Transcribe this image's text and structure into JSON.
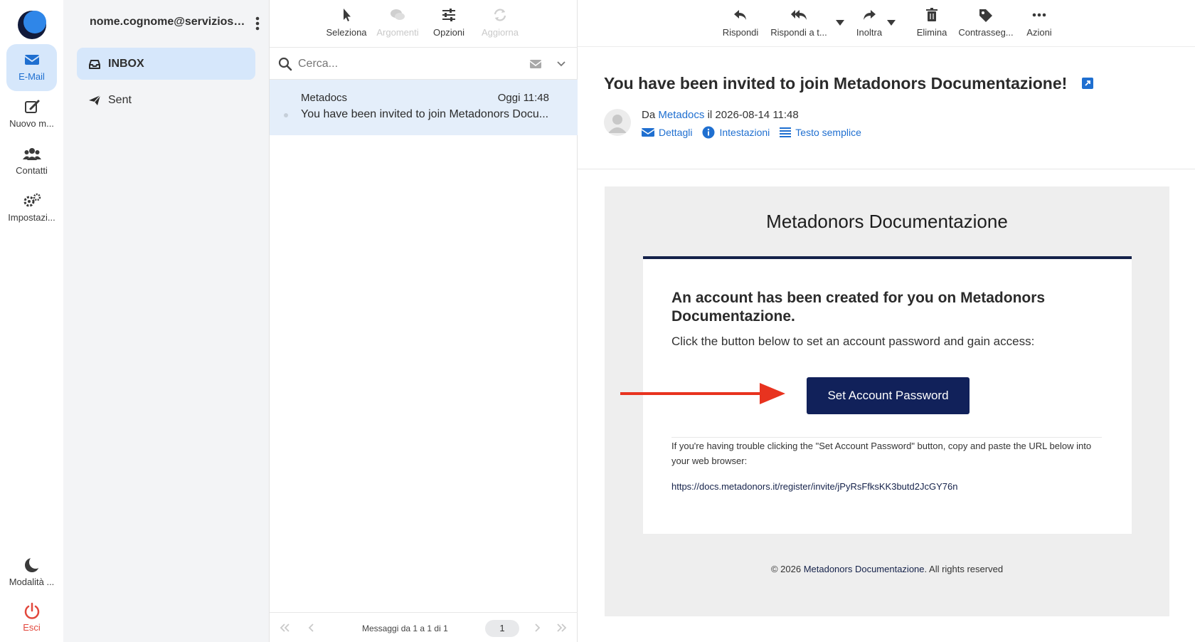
{
  "rail": {
    "items": [
      {
        "label": "E-Mail",
        "icon": "envelope-icon"
      },
      {
        "label": "Nuovo m...",
        "icon": "compose-icon"
      },
      {
        "label": "Contatti",
        "icon": "contacts-icon"
      },
      {
        "label": "Impostazi...",
        "icon": "settings-icon"
      }
    ],
    "dark_mode_label": "Modalità ...",
    "logout_label": "Esci"
  },
  "folders": {
    "account": "nome.cognome@serviziosost...",
    "items": [
      {
        "label": "INBOX",
        "icon": "inbox-icon"
      },
      {
        "label": "Sent",
        "icon": "send-icon"
      }
    ]
  },
  "list": {
    "toolbar": [
      "Seleziona",
      "Argomenti",
      "Opzioni",
      "Aggiorna"
    ],
    "search_placeholder": "Cerca...",
    "message": {
      "from": "Metadocs",
      "date": "Oggi 11:48",
      "subject": "You have been invited to join Metadonors Docu..."
    },
    "pager_info": "Messaggi da 1 a 1 di 1",
    "page": "1"
  },
  "reader": {
    "toolbar": [
      "Rispondi",
      "Rispondi a t...",
      "Inoltra",
      "Elimina",
      "Contrasseg...",
      "Azioni"
    ],
    "subject": "You have been invited to join Metadonors Documentazione!",
    "from_prefix": "Da",
    "from": "Metadocs",
    "date_prefix": "il",
    "date": "2026-08-14 11:48",
    "links": [
      "Dettagli",
      "Intestazioni",
      "Testo semplice"
    ]
  },
  "email": {
    "heading": "Metadonors Documentazione",
    "title": "An account has been created for you on Metadonors Documentazione.",
    "paragraph": "Click the button below to set an account password and gain access:",
    "button": "Set Account Password",
    "trouble": "If you're having trouble clicking the \"Set Account Password\" button, copy and paste the URL below into your web browser:",
    "url": "https://docs.metadonors.it/register/invite/jPyRsFfksKK3butd2JcGY76n",
    "footer_prefix": "© 2026",
    "footer_brand": "Metadonors Documentazione",
    "footer_suffix": ". All rights reserved"
  },
  "colors": {
    "accent": "#1f6fd0",
    "active_bg": "#d6e7fb",
    "button_navy": "#11215a",
    "arrow_red": "#e8331f",
    "logout_red": "#e2483d"
  }
}
